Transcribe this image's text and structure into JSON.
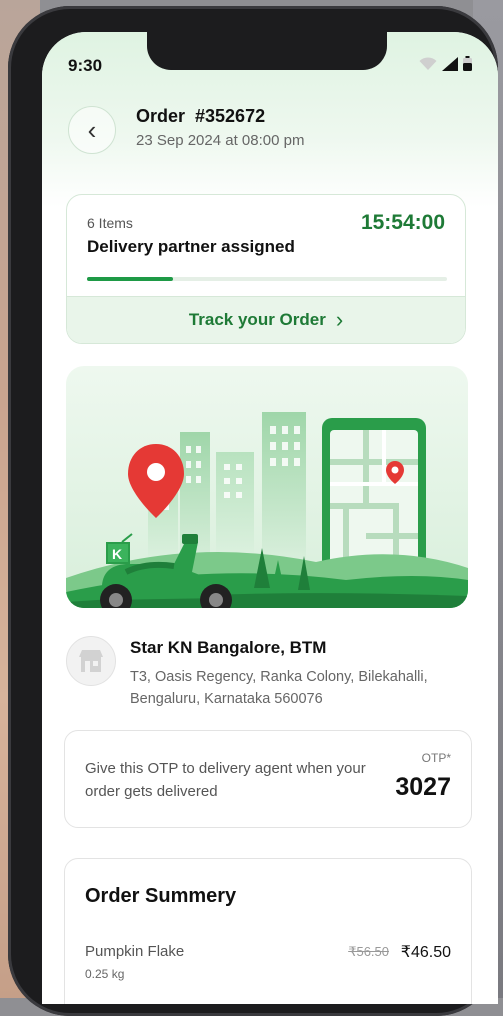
{
  "status_bar": {
    "time": "9:30"
  },
  "header": {
    "title": "Order  #352672",
    "date": "23 Sep 2024 at 08:00 pm",
    "back_glyph": "‹"
  },
  "order_status": {
    "items_count": "6 Items",
    "eta": "15:54:00",
    "status": "Delivery partner assigned",
    "progress_percent": 24,
    "track_label": "Track your Order",
    "track_chevron": "›"
  },
  "illustration": {
    "scooter_logo_letter": "K"
  },
  "store": {
    "name": "Star KN Bangalore, BTM",
    "address": "T3, Oasis Regency, Ranka Colony, Bilekahalli, Bengaluru, Karnataka 560076",
    "icon": "store-icon"
  },
  "otp": {
    "message": "Give this OTP to delivery agent when your order gets delivered",
    "label": "OTP*",
    "value": "3027"
  },
  "order_summary": {
    "title": "Order Summery",
    "items": [
      {
        "name": "Pumpkin Flake",
        "quantity": "0.25 kg",
        "mrp": "₹56.50",
        "price": "₹46.50"
      }
    ]
  },
  "colors": {
    "accent": "#1e7a36",
    "illustration_green": "#2a9d4a",
    "pin_red": "#e53935"
  }
}
